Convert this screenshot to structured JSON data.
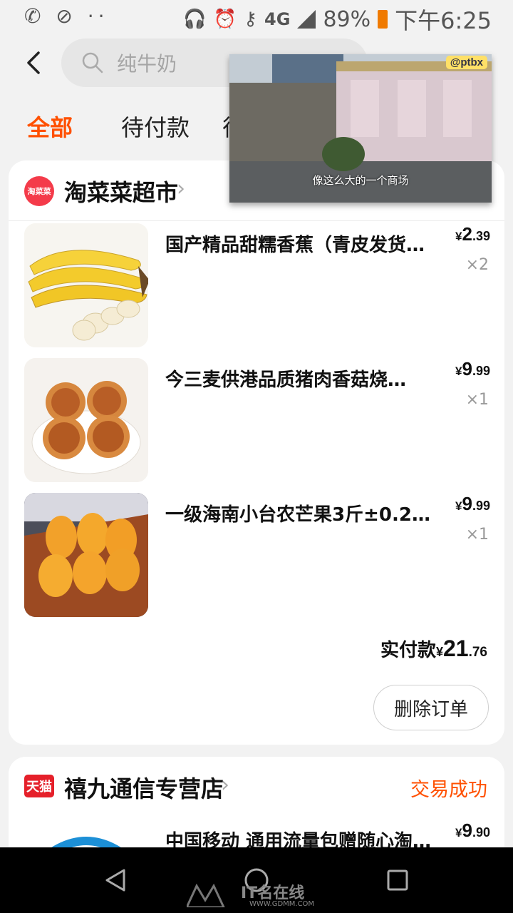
{
  "status_bar": {
    "left_icons": "✆ ⊘ ··",
    "battery": "89%",
    "network": "4G",
    "time": "下午6:25"
  },
  "header": {
    "search_placeholder": "纯牛奶"
  },
  "tabs": [
    {
      "label": "全部",
      "active": true
    },
    {
      "label": "待付款"
    },
    {
      "label": "待"
    }
  ],
  "video_overlay": {
    "tag": "@ptbx",
    "subtitle": "像这么大的一个商场"
  },
  "order1": {
    "shop_logo_text": "淘菜菜",
    "shop_name": "淘菜菜超市",
    "items": [
      {
        "title": "国产精品甜糯香蕉（青皮发货…",
        "price_int": "2",
        "price_dec": ".39",
        "qty": "×2"
      },
      {
        "title": "今三麦供港品质猪肉香菇烧…",
        "price_int": "9",
        "price_dec": ".99",
        "qty": "×1"
      },
      {
        "title": "一级海南小台农芒果3斤±0.2斤…",
        "price_int": "9",
        "price_dec": ".99",
        "qty": "×1"
      }
    ],
    "paid_label": "实付款",
    "paid_currency": "¥",
    "paid_int": "21",
    "paid_dec": ".76",
    "delete_label": "删除订单"
  },
  "order2": {
    "shop_badge": "天猫",
    "shop_name": "禧九通信专营店",
    "status": "交易成功",
    "items": [
      {
        "title": "中国移动 通用流量包赠随心淘…",
        "price_int": "9",
        "price_dec": ".90"
      }
    ]
  },
  "currency": "¥",
  "watermark": {
    "brand": "IT名在线",
    "url": "WWW.GDMM.COM"
  },
  "colors": {
    "accent": "#ff5000",
    "tmall": "#e5202a",
    "taocaicai": "#f43b4a"
  }
}
